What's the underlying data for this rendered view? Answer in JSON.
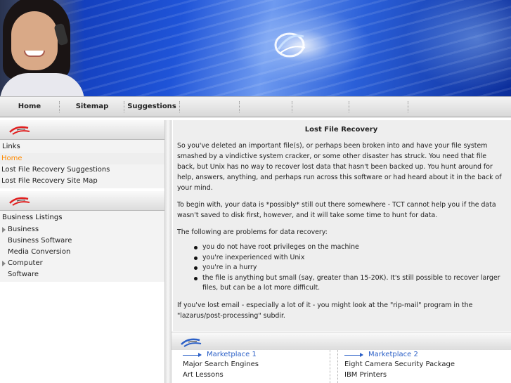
{
  "colors": {
    "accent": "#ff8a00",
    "link_blue": "#2a5fc7",
    "banner_blue": "#1f54d8",
    "panel_bg": "#eeeeee"
  },
  "nav": {
    "items": [
      "Home",
      "Sitemap",
      "Suggestions"
    ]
  },
  "sidebar": {
    "links_title": "Links",
    "links": [
      {
        "label": "Home",
        "active": true
      },
      {
        "label": "Lost File Recovery Suggestions"
      },
      {
        "label": "Lost File Recovery Site Map"
      }
    ],
    "business_title": "Business Listings",
    "business": [
      {
        "label": "Business",
        "expandable": true
      },
      {
        "label": "Business Software"
      },
      {
        "label": "Media Conversion"
      },
      {
        "label": "Computer",
        "expandable": true
      },
      {
        "label": "Software"
      }
    ],
    "header_icon": "swirl-logo-icon"
  },
  "main": {
    "title": "Lost File Recovery",
    "p1": "So you've deleted an important file(s), or perhaps been broken into and have your file system smashed by a vindictive system cracker, or some other disaster has struck. You need that file back, but Unix has no way to recover lost data that hasn't been backed up. You hunt around for help, answers, anything, and perhaps run across this software or had heard about it in the back of your mind.",
    "p2": "To begin with, your data is *possibly* still out there somewhere - TCT cannot help you if the data wasn't saved to disk first, however, and it will take some time to hunt for data.",
    "p3": "The following are problems for data recovery:",
    "bullets": [
      "you do not have root privileges on the machine",
      "you're inexperienced with Unix",
      "you're in a hurry",
      "the file is anything but small (say, greater than 15-20K). It's still possible to recover larger files, but can be a lot more difficult."
    ],
    "p4": "If you've lost email - especially a lot of it - you might look at the \"rip-mail\" program in the \"lazarus/post-processing\" subdir."
  },
  "marketplace": {
    "col1": {
      "title": "Marketplace 1",
      "items": [
        "Major Search Engines",
        "Art Lessons"
      ]
    },
    "col2": {
      "title": "Marketplace 2",
      "items": [
        "Eight Camera Security Package",
        "IBM Printers"
      ]
    }
  }
}
